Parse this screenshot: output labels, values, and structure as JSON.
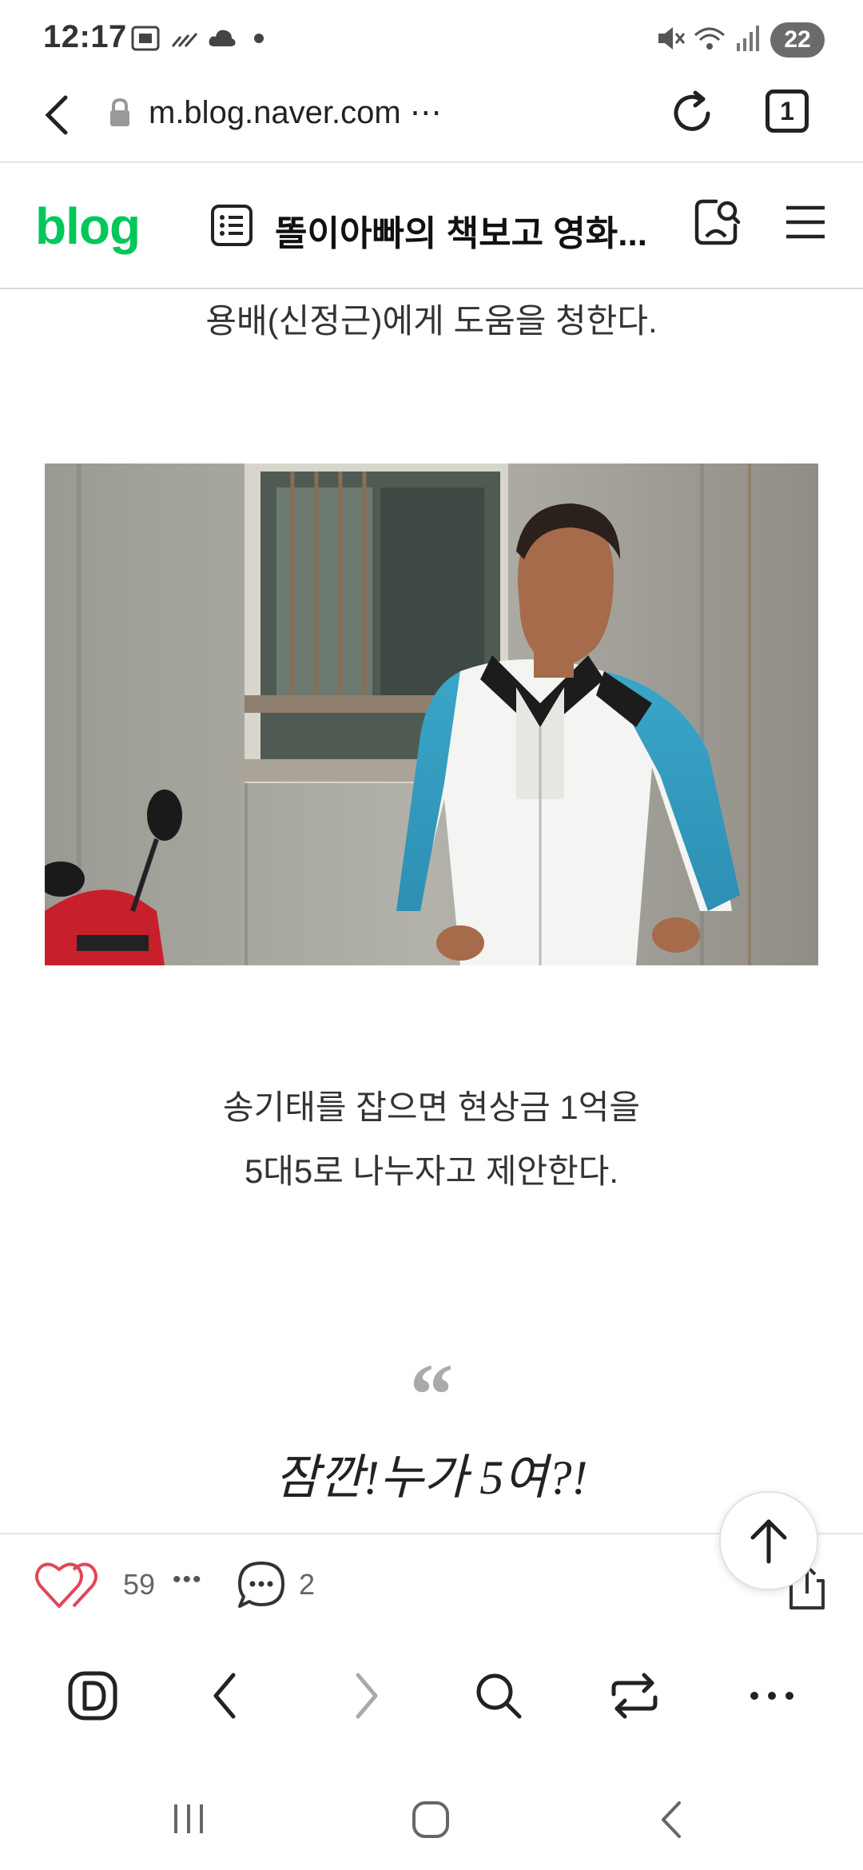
{
  "status": {
    "time": "12:17",
    "battery": "22"
  },
  "browser": {
    "url": "m.blog.naver.com ⋯",
    "tab_count": "1"
  },
  "blog": {
    "logo": "blog",
    "title": "똘이아빠의 책보고 영화..."
  },
  "content": {
    "line1": "용배(신정근)에게 도움을 청한다.",
    "line2": "송기태를 잡으면 현상금 1억을",
    "line3": "5대5로 나누자고 제안한다.",
    "quote_mark": "“",
    "quote": "잠깐!누가 5여?!"
  },
  "reactions": {
    "likes": "59",
    "more": "•••",
    "comments": "2"
  },
  "icons": [
    "gallery-icon",
    "signal-icon",
    "cloud-icon",
    "mute-icon",
    "wifi-icon",
    "lock-icon",
    "refresh-icon",
    "list-icon",
    "search-profile-icon",
    "menu-icon",
    "heart-icon",
    "comment-icon",
    "share-icon",
    "arrow-up-icon",
    "d-icon",
    "back-icon",
    "forward-icon",
    "search-icon",
    "switch-icon",
    "more-icon"
  ],
  "colors": {
    "brand": "#03c75a",
    "heart": "#e2465a"
  }
}
